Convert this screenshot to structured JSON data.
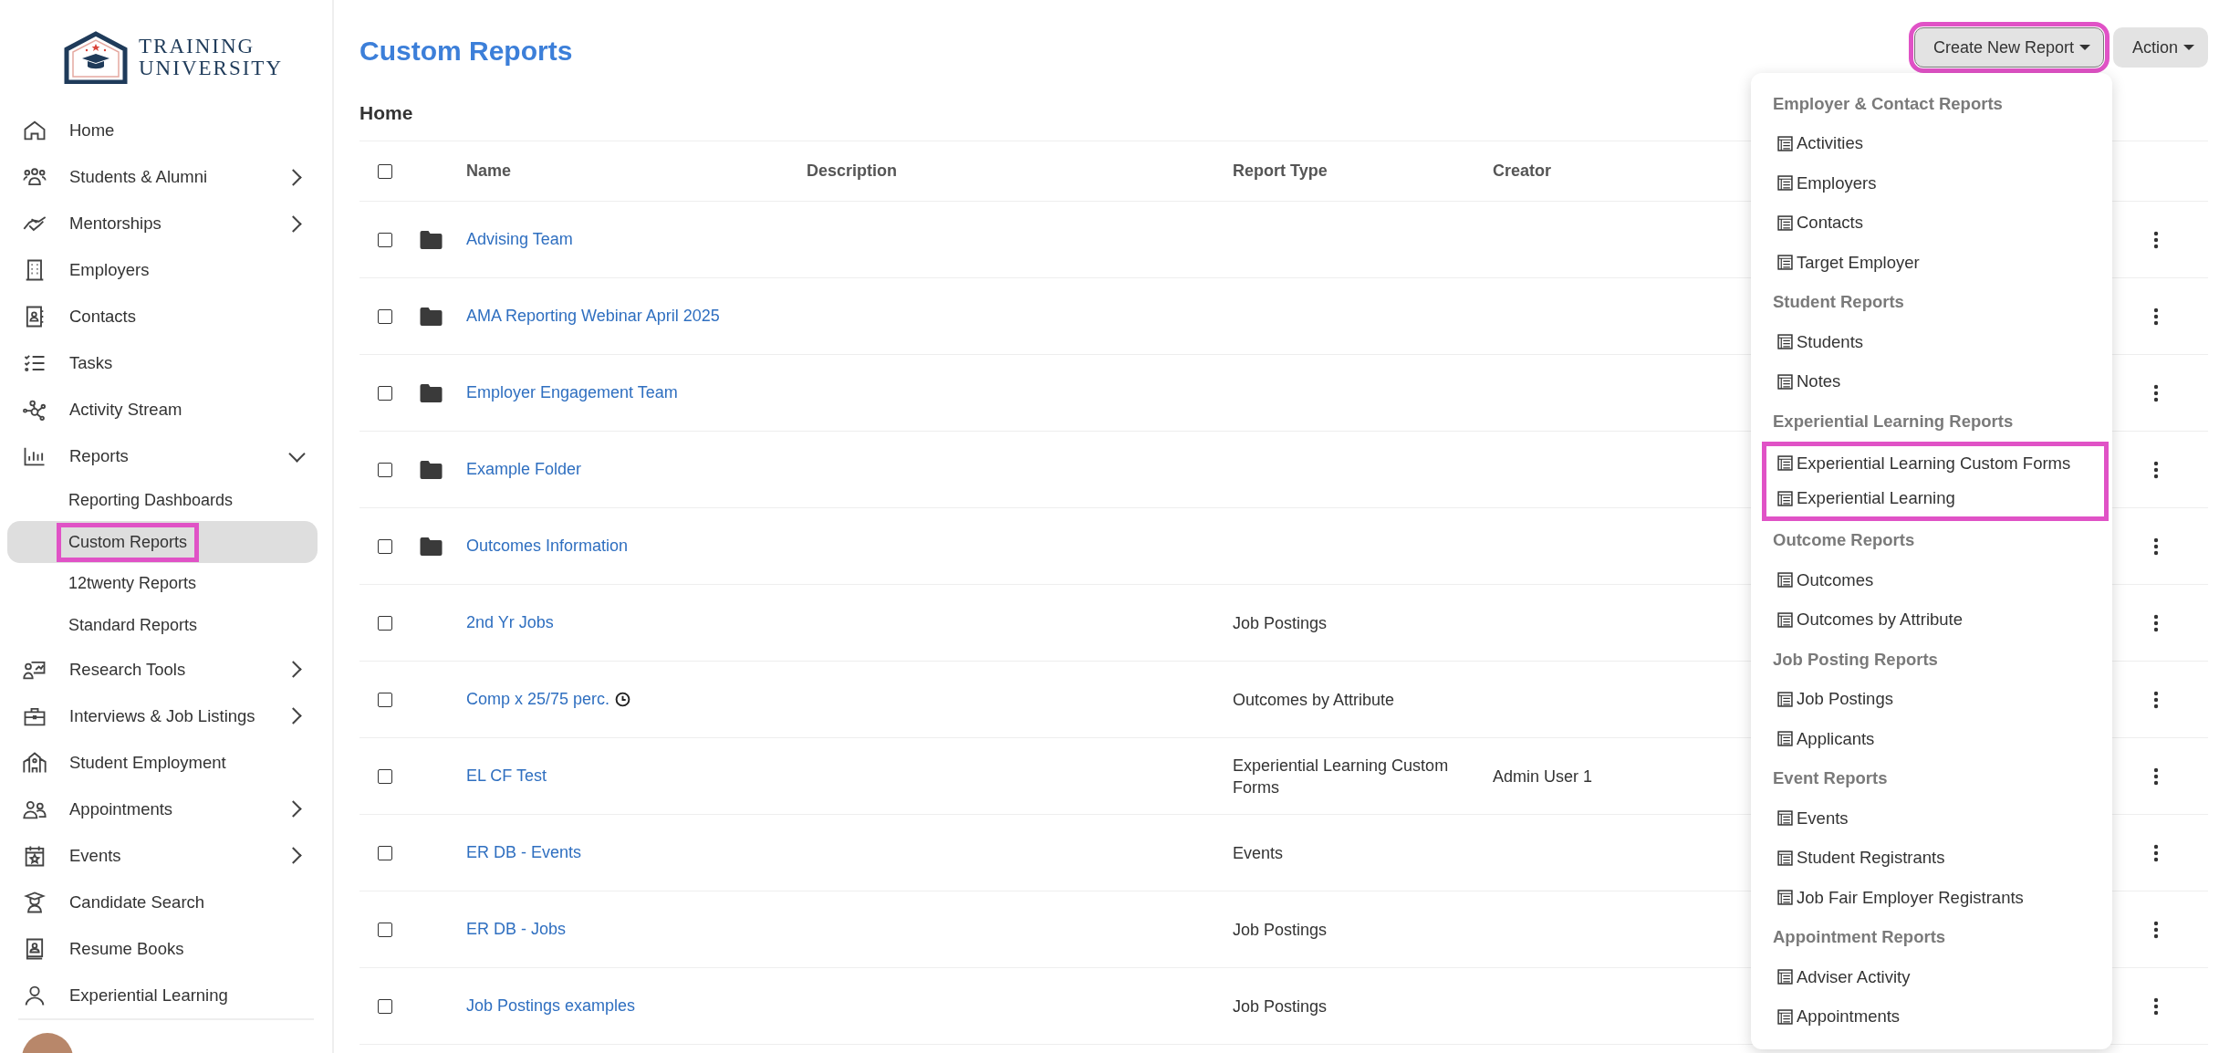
{
  "logo": {
    "line_1": "TRAINING",
    "line_2": "UNIVERSITY"
  },
  "sidebar": {
    "items": [
      {
        "label": "Home",
        "expandable": false
      },
      {
        "label": "Students & Alumni",
        "expandable": true,
        "expanded": false
      },
      {
        "label": "Mentorships",
        "expandable": true,
        "expanded": false
      },
      {
        "label": "Employers",
        "expandable": false
      },
      {
        "label": "Contacts",
        "expandable": false
      },
      {
        "label": "Tasks",
        "expandable": false
      },
      {
        "label": "Activity Stream",
        "expandable": false
      },
      {
        "label": "Reports",
        "expandable": true,
        "expanded": true,
        "children": [
          {
            "label": "Reporting Dashboards",
            "selected": false,
            "highlighted": false
          },
          {
            "label": "Custom Reports",
            "selected": true,
            "highlighted": true
          },
          {
            "label": "12twenty Reports",
            "selected": false,
            "highlighted": false
          },
          {
            "label": "Standard Reports",
            "selected": false,
            "highlighted": false
          }
        ]
      },
      {
        "label": "Research Tools",
        "expandable": true,
        "expanded": false
      },
      {
        "label": "Interviews & Job Listings",
        "expandable": true,
        "expanded": false
      },
      {
        "label": "Student Employment",
        "expandable": false
      },
      {
        "label": "Appointments",
        "expandable": true,
        "expanded": false
      },
      {
        "label": "Events",
        "expandable": true,
        "expanded": false
      },
      {
        "label": "Candidate Search",
        "expandable": false
      },
      {
        "label": "Resume Books",
        "expandable": false
      },
      {
        "label": "Experiential Learning",
        "expandable": false
      }
    ]
  },
  "page": {
    "title": "Custom Reports",
    "folder": "Home"
  },
  "buttons": {
    "create": {
      "label": "Create New Report",
      "highlighted": true
    },
    "action": {
      "label": "Action",
      "highlighted": false
    }
  },
  "table": {
    "select_all": {
      "checked": false
    },
    "columns": [
      "Name",
      "Description",
      "Report Type",
      "Creator"
    ],
    "rows": [
      {
        "kind": "folder",
        "checked": false,
        "name": "Advising Team",
        "scheduled": false
      },
      {
        "kind": "folder",
        "checked": false,
        "name": "AMA Reporting Webinar April 2025",
        "scheduled": false
      },
      {
        "kind": "folder",
        "checked": false,
        "name": "Employer Engagement Team",
        "scheduled": false
      },
      {
        "kind": "folder",
        "checked": false,
        "name": "Example Folder",
        "scheduled": false
      },
      {
        "kind": "folder",
        "checked": false,
        "name": "Outcomes Information",
        "scheduled": false
      },
      {
        "kind": "report",
        "checked": false,
        "name": "2nd Yr Jobs",
        "report_type": "Job Postings",
        "scheduled": false
      },
      {
        "kind": "report",
        "checked": false,
        "name": "Comp x 25/75 perc.",
        "report_type": "Outcomes by Attribute",
        "scheduled": true
      },
      {
        "kind": "report",
        "checked": false,
        "name": "EL CF Test",
        "report_type": "Experiential Learning Custom Forms",
        "creator": "Admin User 1",
        "scheduled": false
      },
      {
        "kind": "report",
        "checked": false,
        "name": "ER DB - Events",
        "report_type": "Events",
        "scheduled": false
      },
      {
        "kind": "report",
        "checked": false,
        "name": "ER DB - Jobs",
        "report_type": "Job Postings",
        "scheduled": false
      },
      {
        "kind": "report",
        "checked": false,
        "name": "Job Postings examples",
        "report_type": "Job Postings",
        "scheduled": false
      }
    ]
  },
  "menu": {
    "sections": [
      {
        "heading": "Employer & Contact Reports",
        "items": [
          {
            "label": "Activities",
            "highlighted": false
          },
          {
            "label": "Employers",
            "highlighted": false
          },
          {
            "label": "Contacts",
            "highlighted": false
          },
          {
            "label": "Target Employer",
            "highlighted": false
          }
        ]
      },
      {
        "heading": "Student Reports",
        "items": [
          {
            "label": "Students",
            "highlighted": false
          },
          {
            "label": "Notes",
            "highlighted": false
          }
        ]
      },
      {
        "heading": "Experiential Learning Reports",
        "items": [
          {
            "label": "Experiential Learning Custom Forms",
            "highlighted": true
          },
          {
            "label": "Experiential Learning",
            "highlighted": true
          }
        ]
      },
      {
        "heading": "Outcome Reports",
        "items": [
          {
            "label": "Outcomes",
            "highlighted": false
          },
          {
            "label": "Outcomes by Attribute",
            "highlighted": false
          }
        ]
      },
      {
        "heading": "Job Posting Reports",
        "items": [
          {
            "label": "Job Postings",
            "highlighted": false
          },
          {
            "label": "Applicants",
            "highlighted": false
          }
        ]
      },
      {
        "heading": "Event Reports",
        "items": [
          {
            "label": "Events",
            "highlighted": false
          },
          {
            "label": "Student Registrants",
            "highlighted": false
          },
          {
            "label": "Job Fair Employer Registrants",
            "highlighted": false
          }
        ]
      },
      {
        "heading": "Appointment Reports",
        "items": [
          {
            "label": "Adviser Activity",
            "highlighted": false
          },
          {
            "label": "Appointments",
            "highlighted": false
          }
        ]
      }
    ]
  }
}
